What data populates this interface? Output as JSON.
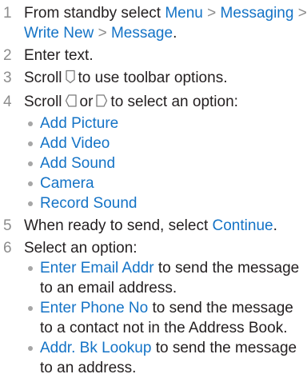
{
  "steps": [
    {
      "num": "1",
      "text_a": "From standby select ",
      "path": [
        "Menu",
        "Messaging",
        "Write New",
        "Message"
      ],
      "sep": ">",
      "text_b": "."
    },
    {
      "num": "2",
      "text_a": "Enter text."
    },
    {
      "num": "3",
      "text_a": "Scroll",
      "icon": "navigation-down-key-icon",
      "text_b": "to use toolbar options."
    },
    {
      "num": "4",
      "text_a": "Scroll",
      "icon_left": "navigation-left-key-icon",
      "or": "or",
      "icon_right": "navigation-right-key-icon",
      "text_b": "to select an option:",
      "options": [
        "Add Picture",
        "Add Video",
        "Add Sound",
        "Camera",
        "Record Sound"
      ]
    },
    {
      "num": "5",
      "text_a": "When ready to send, select ",
      "link": "Continue",
      "text_b": "."
    },
    {
      "num": "6",
      "text_a": "Select an option:",
      "options": [
        {
          "link": "Enter Email Addr",
          "text": " to send the message to an email address."
        },
        {
          "link": "Enter Phone No",
          "text": " to send the message to a contact not in the Address Book."
        },
        {
          "link": "Addr. Bk Lookup",
          "text": " to send the message to an address."
        }
      ]
    }
  ],
  "colors": {
    "link": "#1473c6",
    "step_number": "#8c8c8c",
    "bullet": "#a6a6a6",
    "text": "#231f20"
  }
}
